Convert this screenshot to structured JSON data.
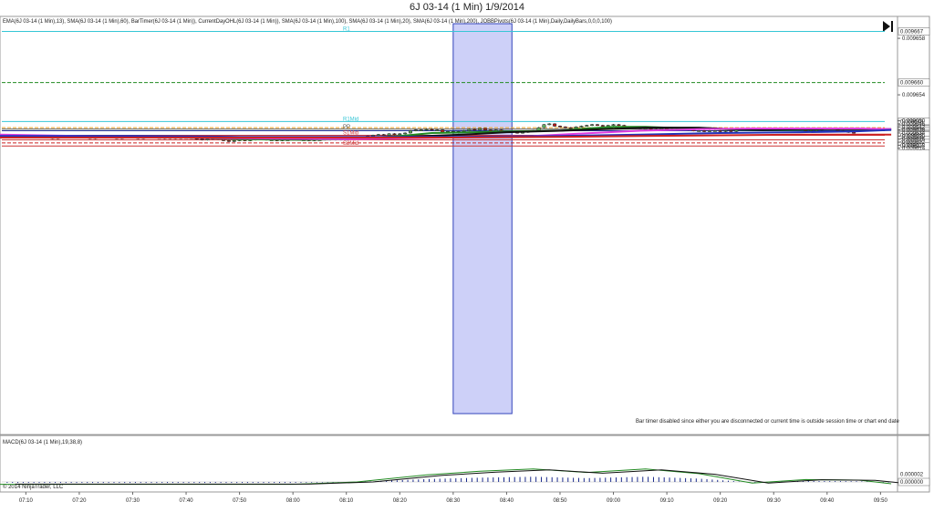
{
  "window": {
    "title": "6J 03-14 (1 Min)  1/9/2014",
    "indicator_line": "EMA(6J 03-14 (1 Min),13), SMA(6J 03-14 (1 Min),60), BarTimer(6J 03-14 (1 Min)), CurrentDayOHL(6J 03-14 (1 Min)), SMA(6J 03-14 (1 Min),100), SMA(6J 03-14 (1 Min),20), SMA(6J 03-14 (1 Min),200), JOBBPivots(6J 03-14 (1 Min),Daily,DailyBars,0,0,0,100)",
    "bar_timer_note": "Bar timer disabled since either you are disconnected or current time is outside session time or chart end date",
    "macd_label": "MACD(6J 03-14 (1 Min),19,38,8)",
    "copyright": "© 2014 NinjaTrader, LLC"
  },
  "chart_data": {
    "type": "candlestick",
    "instrument": "6J 03-14",
    "interval": "1 Min",
    "date": "1/9/2014",
    "y_range": [
      0.096145,
      0.09667
    ],
    "y_ticks": [
      "0.009658",
      "0.009654",
      "0.009650",
      "0.009646",
      "0.009642",
      "0.009638",
      "0.009634",
      "0.009630",
      "0.009626",
      "0.009622",
      "0.009618",
      "0.009614"
    ],
    "y_tick_values": [
      0.096658,
      0.096584,
      0.09655,
      0.096546,
      0.096542,
      0.096538,
      0.096534,
      0.09653,
      0.096526,
      0.096522,
      0.096518,
      0.096514
    ],
    "x_ticks": [
      "07:10",
      "07:20",
      "07:30",
      "07:40",
      "07:50",
      "08:00",
      "08:10",
      "08:20",
      "08:30",
      "08:40",
      "08:50",
      "09:00",
      "09:10",
      "09:20",
      "09:30",
      "09:40",
      "09:50"
    ],
    "x_tick_minutes": [
      430,
      440,
      450,
      460,
      470,
      480,
      490,
      500,
      510,
      520,
      530,
      540,
      550,
      560,
      570,
      580,
      590
    ],
    "x_range_minutes": [
      425.5,
      592.5
    ],
    "highlight": {
      "start": "08:30",
      "end": "08:41",
      "color": "#bcc0f5"
    },
    "pivot_levels": [
      {
        "name": "R1",
        "price": 0.096667,
        "color": "#36c6d6",
        "style": "solid"
      },
      {
        "name": "",
        "price": 0.0966,
        "color": "#228b22",
        "style": "dashed"
      },
      {
        "name": "R1Mid",
        "price": 0.096549,
        "color": "#36c6d6",
        "style": "solid"
      },
      {
        "name": "",
        "price": 0.096541,
        "color": "#f0a020",
        "style": "dashed"
      },
      {
        "name": "PP",
        "price": 0.096539,
        "color": "#555555",
        "style": "solid"
      },
      {
        "name": "",
        "price": 0.096537,
        "color": "#223399",
        "style": "solid"
      },
      {
        "name": "S1Mid",
        "price": 0.096531,
        "color": "#cc3333",
        "style": "solid"
      },
      {
        "name": "",
        "price": 0.096525,
        "color": "#cc3333",
        "style": "solid"
      },
      {
        "name": "",
        "price": 0.096521,
        "color": "#cc2222",
        "style": "dashed"
      },
      {
        "name": "S2Mid",
        "price": 0.096517,
        "color": "#cc3333",
        "style": "solid"
      }
    ],
    "price_markers": [
      {
        "label": "0.009667",
        "price": 0.096667
      },
      {
        "label": "0.009660",
        "price": 0.0966
      },
      {
        "label": "0.009649",
        "price": 0.096549
      },
      {
        "label": "0.009639",
        "price": 0.09654
      },
      {
        "label": "0.009538",
        "price": 0.096539
      },
      {
        "label": "0.009537",
        "price": 0.096537
      },
      {
        "label": "0.009634",
        "price": 0.096534
      },
      {
        "label": "0.009533",
        "price": 0.096532
      },
      {
        "label": "0.009632",
        "price": 0.096531
      },
      {
        "label": "0.009626",
        "price": 0.096525
      },
      {
        "label": "0.009621",
        "price": 0.096521
      },
      {
        "label": "0.009617",
        "price": 0.096517
      }
    ],
    "candles": {
      "start": "07:05",
      "step_minutes": 1,
      "closes": [
        0.096529,
        0.096528,
        0.096529,
        0.09653,
        0.096529,
        0.096528,
        0.096529,
        0.09653,
        0.096529,
        0.096528,
        0.096527,
        0.096528,
        0.096529,
        0.096528,
        0.09653,
        0.096529,
        0.096528,
        0.096527,
        0.096528,
        0.096529,
        0.09653,
        0.096528,
        0.096527,
        0.096528,
        0.096529,
        0.096528,
        0.096527,
        0.096528,
        0.096529,
        0.096528,
        0.096528,
        0.096527,
        0.096528,
        0.096527,
        0.096528,
        0.096528,
        0.096527,
        0.096526,
        0.096525,
        0.096526,
        0.096527,
        0.096526,
        0.096524,
        0.096523,
        0.096524,
        0.096525,
        0.096524,
        0.096525,
        0.096526,
        0.096526,
        0.096525,
        0.096525,
        0.096524,
        0.096525,
        0.096525,
        0.096526,
        0.096525,
        0.096525,
        0.096524,
        0.096525,
        0.096525,
        0.096526,
        0.096525,
        0.096526,
        0.096525,
        0.096527,
        0.096527,
        0.096529,
        0.096528,
        0.09653,
        0.096531,
        0.096532,
        0.096531,
        0.096533,
        0.096532,
        0.096533,
        0.096534,
        0.096537,
        0.096538,
        0.096538,
        0.096539,
        0.096538,
        0.096538,
        0.096535,
        0.096536,
        0.096534,
        0.096536,
        0.096537,
        0.096539,
        0.096538,
        0.09654,
        0.096538,
        0.096537,
        0.096538,
        0.096536,
        0.096536,
        0.096535,
        0.096534,
        0.096535,
        0.096536,
        0.096537,
        0.096541,
        0.096545,
        0.096546,
        0.096543,
        0.096542,
        0.096541,
        0.09654,
        0.096542,
        0.096543,
        0.096544,
        0.096545,
        0.096544,
        0.096543,
        0.096544,
        0.096545,
        0.096544,
        0.096542,
        0.096541,
        0.096541,
        0.09654,
        0.09654,
        0.096539,
        0.096539,
        0.09654,
        0.096539,
        0.096539,
        0.09654,
        0.096539,
        0.096538,
        0.096537,
        0.096537,
        0.096536,
        0.096537,
        0.096537,
        0.096536,
        0.096537,
        0.096536,
        0.096538,
        0.096539,
        0.09654,
        0.09654,
        0.096539,
        0.096539,
        0.09654,
        0.09654,
        0.09654,
        0.096539,
        0.096539,
        0.096539,
        0.096538,
        0.096537,
        0.096537,
        0.096538,
        0.096539,
        0.09654,
        0.096539,
        0.096537,
        0.096536,
        0.096535,
        0.096534
      ]
    },
    "series": [
      {
        "name": "EMA 13",
        "color": "#228b22",
        "points": [
          [
            425,
            0.096531
          ],
          [
            440,
            0.096529
          ],
          [
            460,
            0.096528
          ],
          [
            470,
            0.096526
          ],
          [
            482,
            0.096525
          ],
          [
            490,
            0.096526
          ],
          [
            500,
            0.09653
          ],
          [
            506,
            0.096534
          ],
          [
            514,
            0.096535
          ],
          [
            520,
            0.096536
          ],
          [
            530,
            0.096537
          ],
          [
            535,
            0.09654
          ],
          [
            540,
            0.096542
          ],
          [
            546,
            0.096542
          ],
          [
            550,
            0.096541
          ],
          [
            556,
            0.09654
          ],
          [
            560,
            0.096539
          ],
          [
            566,
            0.096538
          ],
          [
            572,
            0.096538
          ],
          [
            580,
            0.096539
          ],
          [
            586,
            0.096539
          ],
          [
            592,
            0.096538
          ]
        ]
      },
      {
        "name": "SMA 20",
        "color": "#111111",
        "points": [
          [
            425,
            0.09653
          ],
          [
            440,
            0.096529
          ],
          [
            460,
            0.096528
          ],
          [
            470,
            0.096527
          ],
          [
            482,
            0.096526
          ],
          [
            495,
            0.096527
          ],
          [
            505,
            0.09653
          ],
          [
            512,
            0.096532
          ],
          [
            520,
            0.096535
          ],
          [
            530,
            0.096537
          ],
          [
            538,
            0.096539
          ],
          [
            546,
            0.096541
          ],
          [
            556,
            0.096541
          ],
          [
            562,
            0.096539
          ],
          [
            568,
            0.096538
          ],
          [
            575,
            0.096539
          ],
          [
            584,
            0.096539
          ],
          [
            592,
            0.096539
          ]
        ]
      },
      {
        "name": "SMA 60",
        "color": "#e03ce0",
        "points": [
          [
            425,
            0.096532
          ],
          [
            440,
            0.09653
          ],
          [
            460,
            0.096528
          ],
          [
            470,
            0.096527
          ],
          [
            490,
            0.096526
          ],
          [
            510,
            0.096528
          ],
          [
            525,
            0.09653
          ],
          [
            536,
            0.096534
          ],
          [
            545,
            0.096537
          ],
          [
            556,
            0.096539
          ],
          [
            566,
            0.09654
          ],
          [
            576,
            0.09654
          ],
          [
            586,
            0.09654
          ],
          [
            592,
            0.096539
          ]
        ]
      },
      {
        "name": "SMA 100",
        "color": "#2233bb",
        "points": [
          [
            425,
            0.09653
          ],
          [
            450,
            0.09653
          ],
          [
            470,
            0.096529
          ],
          [
            490,
            0.096529
          ],
          [
            510,
            0.096529
          ],
          [
            530,
            0.09653
          ],
          [
            545,
            0.096532
          ],
          [
            560,
            0.096534
          ],
          [
            575,
            0.096535
          ],
          [
            585,
            0.096536
          ],
          [
            592,
            0.096538
          ]
        ]
      },
      {
        "name": "SMA 200",
        "color": "#cc2222",
        "points": [
          [
            425,
            0.096528
          ],
          [
            450,
            0.096528
          ],
          [
            470,
            0.096528
          ],
          [
            490,
            0.096528
          ],
          [
            510,
            0.096528
          ],
          [
            530,
            0.096529
          ],
          [
            545,
            0.09653
          ],
          [
            560,
            0.096531
          ],
          [
            575,
            0.096532
          ],
          [
            592,
            0.096532
          ]
        ]
      }
    ],
    "macd": {
      "zero_label": "0.000000",
      "level_label": "0.000002",
      "line_color": "#228b22",
      "signal_color": "#111111",
      "hist_color": "#1a2a8a",
      "points": [
        [
          425,
          -4e-07
        ],
        [
          480,
          -4e-07
        ],
        [
          492,
          0.0
        ],
        [
          505,
          1.2e-06
        ],
        [
          515,
          1.8e-06
        ],
        [
          525,
          2.2e-06
        ],
        [
          535,
          1.6e-06
        ],
        [
          546,
          2.2e-06
        ],
        [
          556,
          1.4e-06
        ],
        [
          566,
          -2e-07
        ],
        [
          576,
          4e-07
        ],
        [
          586,
          3e-07
        ],
        [
          592,
          -3e-07
        ]
      ]
    }
  }
}
